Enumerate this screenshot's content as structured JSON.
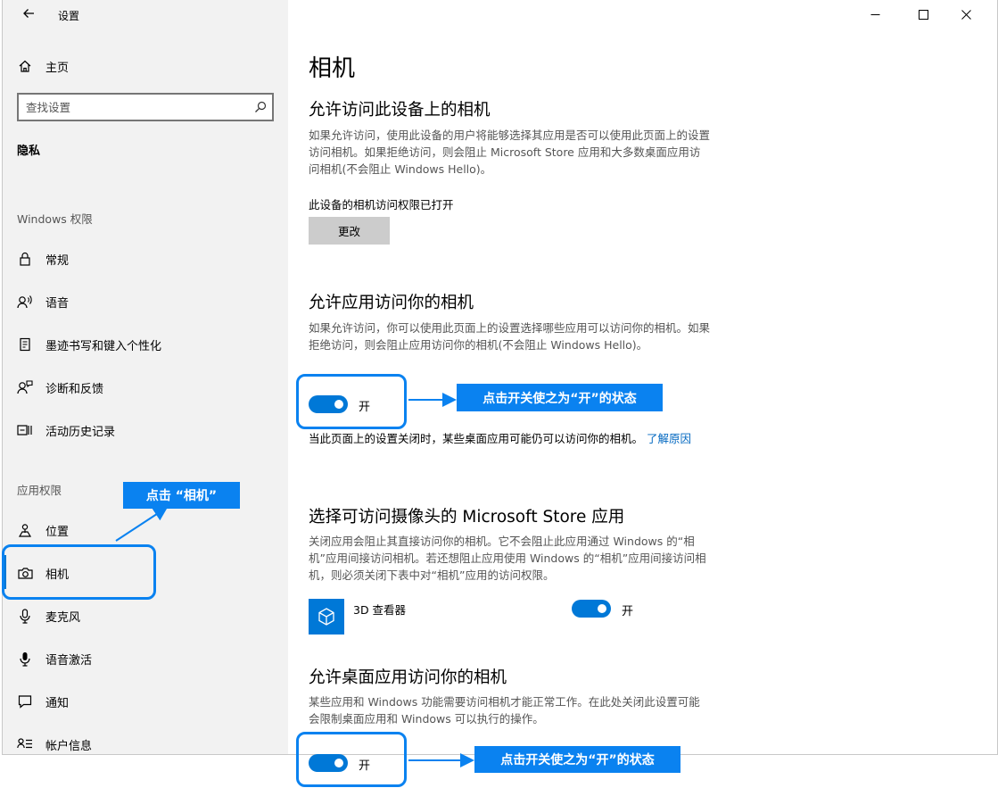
{
  "window": {
    "title": "设置",
    "accent": "#0078d7",
    "annotation_color": "#0a82f0"
  },
  "sidebar": {
    "home_label": "主页",
    "search_placeholder": "查找设置",
    "section_title": "隐私",
    "groups": [
      {
        "title": "Windows 权限",
        "items": [
          {
            "label": "常规",
            "icon": "lock-icon"
          },
          {
            "label": "语音",
            "icon": "speech-icon"
          },
          {
            "label": "墨迹书写和键入个性化",
            "icon": "ink-icon"
          },
          {
            "label": "诊断和反馈",
            "icon": "feedback-icon"
          },
          {
            "label": "活动历史记录",
            "icon": "activity-icon"
          }
        ]
      },
      {
        "title": "应用权限",
        "items": [
          {
            "label": "位置",
            "icon": "location-icon"
          },
          {
            "label": "相机",
            "icon": "camera-icon",
            "selected": true
          },
          {
            "label": "麦克风",
            "icon": "microphone-icon"
          },
          {
            "label": "语音激活",
            "icon": "voice-activation-icon"
          },
          {
            "label": "通知",
            "icon": "notification-icon"
          },
          {
            "label": "帐户信息",
            "icon": "account-info-icon"
          }
        ]
      }
    ]
  },
  "main": {
    "page_title": "相机",
    "device_access": {
      "heading": "允许访问此设备上的相机",
      "description": "如果允许访问，使用此设备的用户将能够选择其应用是否可以使用此页面上的设置访问相机。如果拒绝访问，则会阻止 Microsoft Store 应用和大多数桌面应用访问相机(不会阻止 Windows Hello)。",
      "status": "此设备的相机访问权限已打开",
      "change_button": "更改"
    },
    "app_access": {
      "heading": "允许应用访问你的相机",
      "description": "如果允许访问，你可以使用此页面上的设置选择哪些应用可以访问你的相机。如果拒绝访问，则会阻止应用访问你的相机(不会阻止 Windows Hello)。",
      "toggle_state": "开",
      "note": "当此页面上的设置关闭时，某些桌面应用可能仍可以访问你的相机。",
      "learn_more": "了解原因"
    },
    "store_apps": {
      "heading": "选择可访问摄像头的 Microsoft Store 应用",
      "description": "关闭应用会阻止其直接访问你的相机。它不会阻止此应用通过 Windows 的“相机”应用间接访问相机。若还想阻止应用使用 Windows 的“相机”应用间接访问相机，则必须关闭下表中对“相机”应用的访问权限。",
      "apps": [
        {
          "name": "3D 查看器",
          "toggle_state": "开",
          "icon": "cube-icon"
        }
      ]
    },
    "desktop_apps": {
      "heading": "允许桌面应用访问你的相机",
      "description": "某些应用和 Windows 功能需要访问相机才能正常工作。在此处关闭此设置可能会限制桌面应用和 Windows 可以执行的操作。",
      "toggle_state": "开"
    }
  },
  "annotations": {
    "click_camera": "点击 “相机”",
    "toggle_on_1": "点击开关使之为“开”的状态",
    "toggle_on_2": "点击开关使之为“开”的状态"
  }
}
